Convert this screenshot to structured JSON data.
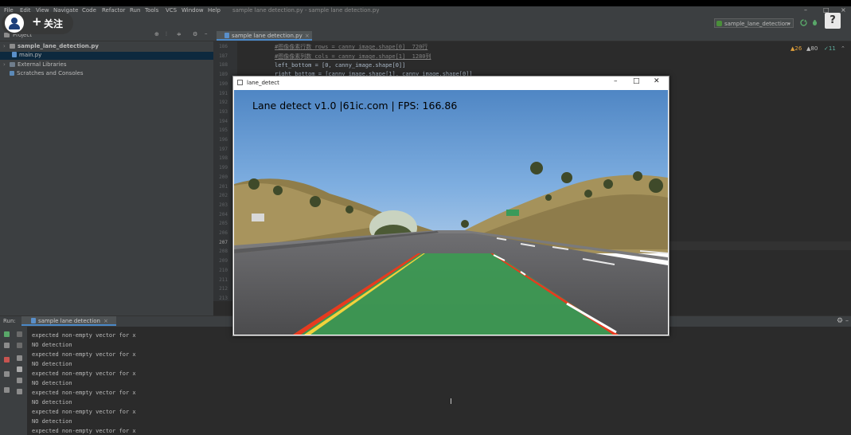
{
  "overlay": {
    "follow_label": "关注",
    "plus": "+"
  },
  "menubar": {
    "items": [
      "File",
      "Edit",
      "View",
      "Navigate",
      "Code",
      "Refactor",
      "Run",
      "Tools",
      "VCS",
      "Window",
      "Help"
    ],
    "window_title": "sample lane detection.py - sample lane detection.py",
    "controls": [
      "–",
      "□",
      "×"
    ]
  },
  "toolbar": {
    "run_config": "sample_lane_detection",
    "help": "?"
  },
  "project": {
    "header": "Project",
    "items": [
      {
        "label": "sample_lane_detection.py",
        "type": "folder"
      },
      {
        "label": "main.py",
        "type": "file"
      },
      {
        "label": "External Libraries",
        "type": "folder"
      },
      {
        "label": "Scratches and Consoles",
        "type": "scratch"
      }
    ]
  },
  "editor": {
    "tab": "sample lane detection.py",
    "inspections": {
      "warnings": "26",
      "weak": "80",
      "ok": "11"
    },
    "line_numbers": [
      "186",
      "187",
      "188",
      "189",
      "190",
      "191",
      "192",
      "193",
      "194",
      "195",
      "196",
      "197",
      "198",
      "199",
      "200",
      "201",
      "202",
      "203",
      "204",
      "205",
      "206",
      "207",
      "208",
      "209",
      "210",
      "211",
      "212",
      "213"
    ],
    "code_lines": [
      {
        "text": "#图像像素行数 rows = canny_image.shape[0]  720行",
        "comment": true
      },
      {
        "text": "#图像像素列数 cols = canny_image.shape[1]  1280列",
        "comment": true
      },
      {
        "text": "left_bottom = [0, canny_image.shape[0]]",
        "comment": false
      },
      {
        "text": "right_bottom = [canny_image.shape[1], canny_image.shape[0]]",
        "comment": false
      }
    ]
  },
  "cv_window": {
    "title": "lane_detect",
    "hud_text": "Lane detect v1.0 |61ic.com | FPS: 166.86",
    "controls": [
      "–",
      "□",
      "✕"
    ]
  },
  "run_panel": {
    "label": "Run:",
    "tab": "sample lane detection",
    "lines": [
      "expected non-empty vector for x",
      "NO detection",
      "expected non-empty vector for x",
      "NO detection",
      "expected non-empty vector for x",
      "NO detection",
      "expected non-empty vector for x",
      "NO detection",
      "expected non-empty vector for x",
      "NO detection",
      "expected non-empty vector for x"
    ]
  },
  "colors": {
    "lane_fill": "#3c9a52",
    "lane_left": "#f2d23c",
    "lane_right": "#e83a1f",
    "accent": "#4a88c7"
  }
}
